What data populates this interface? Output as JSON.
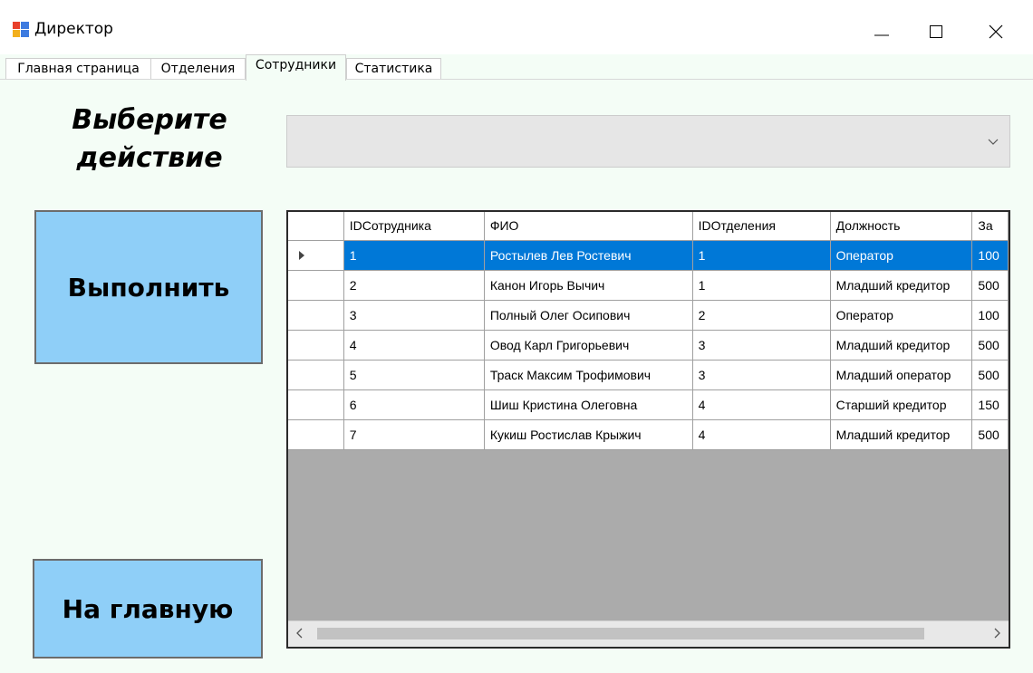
{
  "window": {
    "title": "Директор"
  },
  "tabs": [
    {
      "label": "Главная страница"
    },
    {
      "label": "Отделения"
    },
    {
      "label": "Сотрудники"
    },
    {
      "label": "Статистика"
    }
  ],
  "active_tab": "Сотрудники",
  "action": {
    "heading_line1": "Выберите",
    "heading_line2": "действие",
    "combo_value": ""
  },
  "buttons": {
    "run": "Выполнить",
    "home": "На главную"
  },
  "grid": {
    "columns": [
      "IDСотрудника",
      "ФИО",
      "IDОтделения",
      "Должность",
      "За"
    ],
    "rows": [
      [
        "1",
        "Ростылев Лев Ростевич",
        "1",
        "Оператор",
        "100"
      ],
      [
        "2",
        "Канон Игорь Вычич",
        "1",
        "Младший кредитор",
        "500"
      ],
      [
        "3",
        "Полный Олег Осипович",
        "2",
        "Оператор",
        "100"
      ],
      [
        "4",
        "Овод Карл Григорьевич",
        "3",
        "Младший кредитор",
        "500"
      ],
      [
        "5",
        "Траск Максим Трофимович",
        "3",
        "Младший оператор",
        "500"
      ],
      [
        "6",
        "Шиш Кристина Олеговна",
        "4",
        "Старший кредитор",
        "150"
      ],
      [
        "7",
        "Кукиш Ростислав Крыжич",
        "4",
        "Младший кредитор",
        "500"
      ]
    ],
    "selected_row": 0
  },
  "colors": {
    "panel_bg": "#f4fdf6",
    "button_bg": "#8fcff8",
    "selection": "#0078d7",
    "grid_empty": "#ababab"
  }
}
